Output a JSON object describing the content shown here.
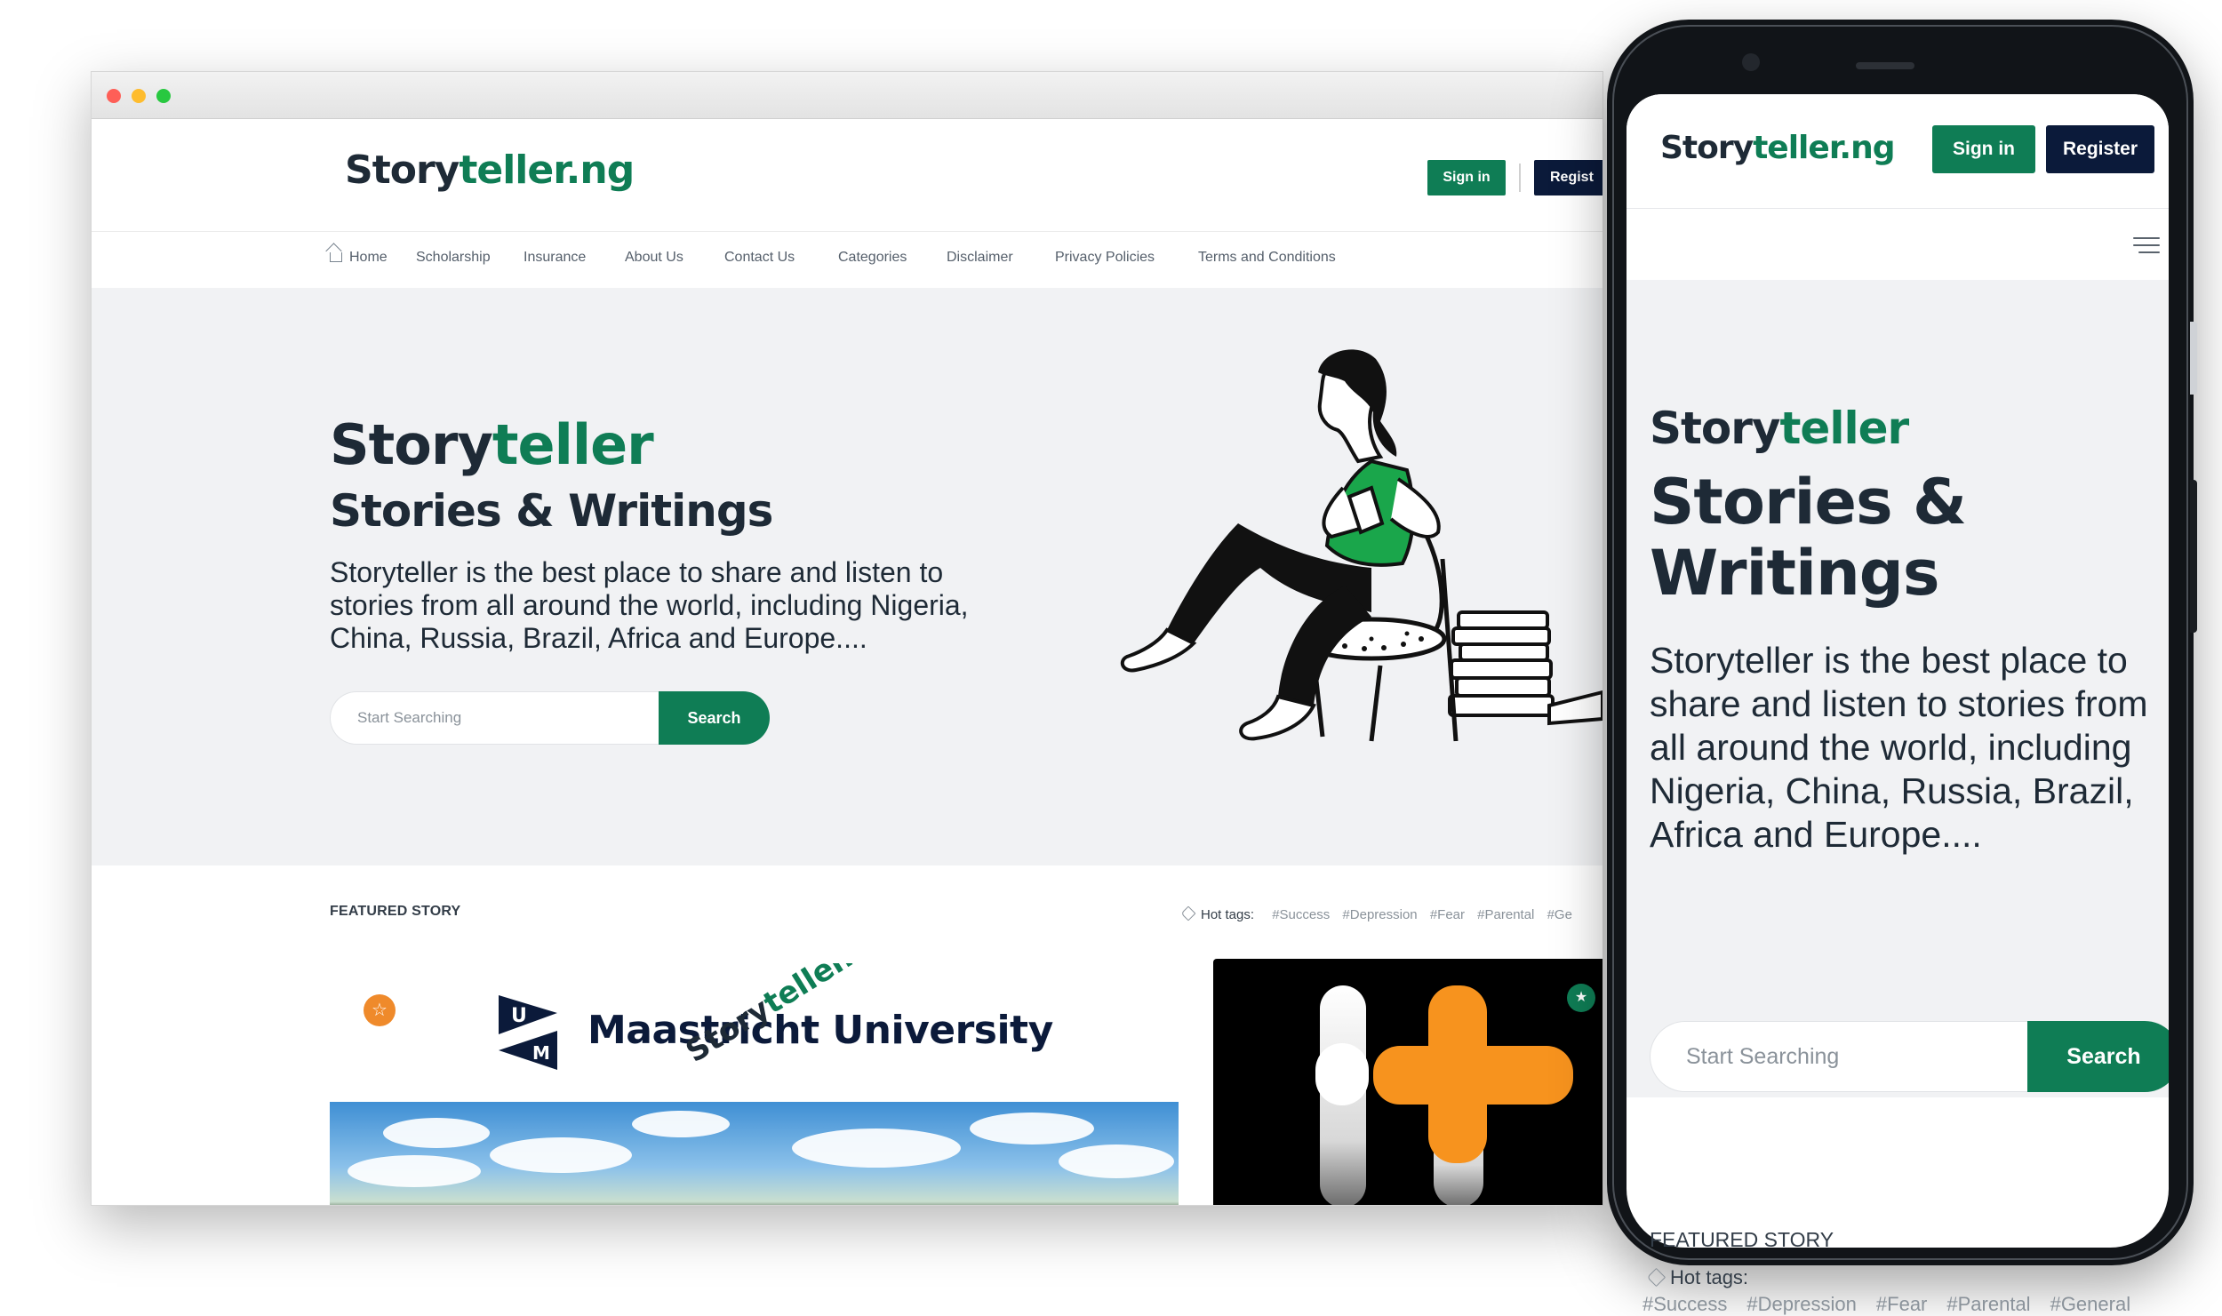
{
  "desktop": {
    "logo": {
      "part1": "Story",
      "part2": "teller.ng"
    },
    "header": {
      "signin": "Sign in",
      "register": "Regist"
    },
    "nav": [
      "Home",
      "Scholarship",
      "Insurance",
      "About Us",
      "Contact Us",
      "Categories",
      "Disclaimer",
      "Privacy Policies",
      "Terms and Conditions"
    ],
    "hero": {
      "title_part1": "Story",
      "title_part2": "teller",
      "subtitle": "Stories & Writings",
      "description": "Storyteller is the best place to share and listen to stories from all around the world, including Nigeria, China, Russia, Brazil, Africa and Europe....",
      "search_placeholder": "Start Searching",
      "search_button": "Search"
    },
    "featured": {
      "label": "FEATURED STORY",
      "hot_tags_label": "Hot tags:",
      "tags": [
        "#Success",
        "#Depression",
        "#Fear",
        "#Parental",
        "#Ge"
      ]
    },
    "card1": {
      "badge_icon": "star-icon",
      "logo_letters": [
        "U",
        "M"
      ],
      "university": "Maastricht University",
      "watermark_part1": "Story",
      "watermark_part2": "teller.ng"
    },
    "card2": {
      "badge_icon": "star-icon"
    }
  },
  "mobile": {
    "logo": {
      "part1": "Story",
      "part2": "teller.ng"
    },
    "header": {
      "signin": "Sign in",
      "register": "Register"
    },
    "menu_icon": "hamburger-menu-icon",
    "hero": {
      "title_part1": "Story",
      "title_part2": "teller",
      "subtitle": "Stories & Writings",
      "description": "Storyteller is the best place to share and listen to stories from all around the world, including Nigeria, China, Russia, Brazil, Africa and Europe....",
      "search_placeholder": "Start Searching",
      "search_button": "Search"
    },
    "featured": {
      "label": "FEATURED STORY",
      "hot_tags_label": "Hot tags:",
      "tags": [
        "#Success",
        "#Depression",
        "#Fear",
        "#Parental",
        "#General"
      ]
    }
  },
  "colors": {
    "brand_green": "#0f7d55",
    "navy": "#0b1a3a",
    "text_dark": "#1e2a36",
    "hero_bg": "#f1f2f4",
    "badge_orange": "#ef8a2b",
    "plus_orange": "#f7931e"
  }
}
